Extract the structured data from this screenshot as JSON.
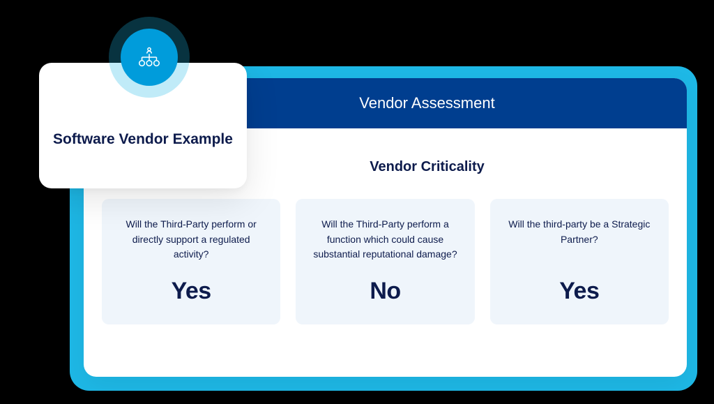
{
  "example_card": {
    "title": "Software Vendor Example",
    "icon": "org-hierarchy-icon"
  },
  "assessment": {
    "header": "Vendor Assessment",
    "section_title": "Vendor Criticality",
    "cards": [
      {
        "question": "Will the Third-Party perform or directly support a regulated activity?",
        "answer": "Yes"
      },
      {
        "question": "Will the Third-Party perform a function which could cause substantial reputational damage?",
        "answer": "No"
      },
      {
        "question": "Will the third-party be a Strategic Partner?",
        "answer": "Yes"
      }
    ]
  },
  "colors": {
    "cyan": "#1EB8E6",
    "header_blue": "#003E8F",
    "card_bg": "#EFF5FB",
    "text_navy": "#0D1B4C"
  }
}
